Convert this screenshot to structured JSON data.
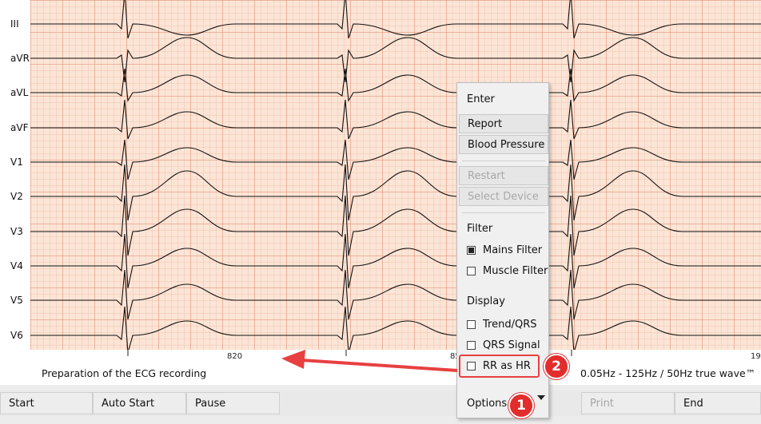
{
  "leads": [
    "III",
    "aVR",
    "aVL",
    "aVF",
    "V1",
    "V2",
    "V3",
    "V4",
    "V5",
    "V6"
  ],
  "ticks": [
    "820",
    "85",
    "19"
  ],
  "status": {
    "preparation": "Preparation of the ECG recording",
    "filter": "0.05Hz - 125Hz / 50Hz true wave™"
  },
  "bottom_buttons": {
    "start": "Start",
    "auto_start": "Auto Start",
    "pause": "Pause",
    "options": "Options",
    "print": "Print",
    "end": "End"
  },
  "menu": {
    "enter": "Enter",
    "report": "Report",
    "blood_pressure": "Blood Pressure",
    "restart": "Restart",
    "select_device": "Select Device",
    "filter_heading": "Filter",
    "mains_filter": "Mains Filter",
    "mains_filter_checked": true,
    "muscle_filter": "Muscle Filter",
    "muscle_filter_checked": false,
    "display_heading": "Display",
    "trend_qrs": "Trend/QRS",
    "trend_qrs_checked": false,
    "qrs_signal": "QRS Signal",
    "qrs_signal_checked": false,
    "rr_as_hr": "RR as HR",
    "rr_as_hr_checked": false
  },
  "annotations": {
    "badge1": "1",
    "badge2": "2"
  },
  "colors": {
    "grid_bg": "#fce5d6",
    "accent_red": "#e32c2c"
  }
}
